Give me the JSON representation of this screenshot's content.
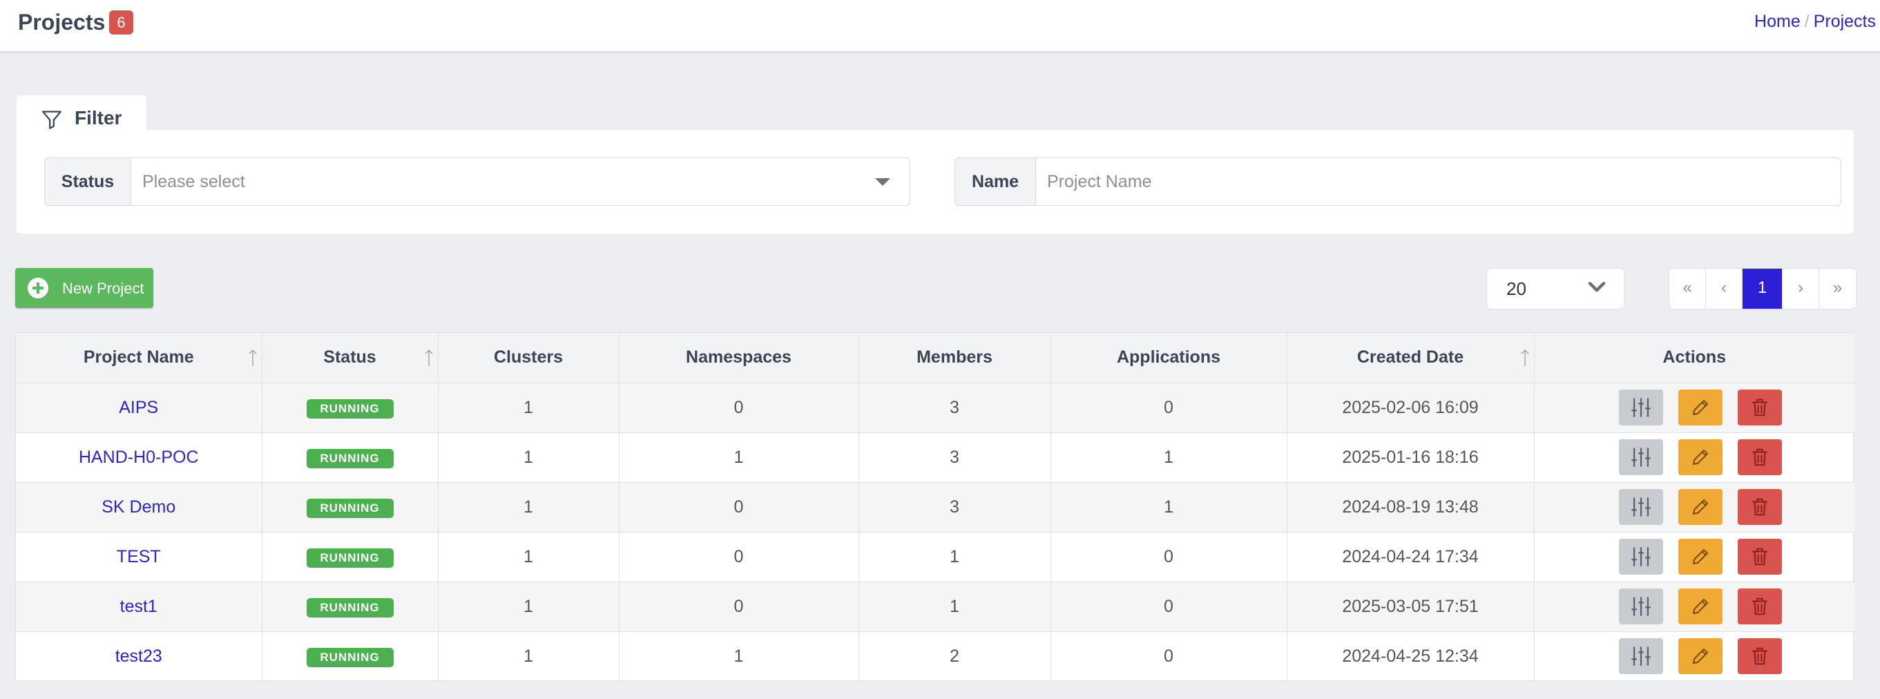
{
  "header": {
    "title": "Projects",
    "count": "6",
    "breadcrumb": {
      "home": "Home",
      "separator": "/",
      "current": "Projects"
    }
  },
  "filter": {
    "tab_label": "Filter",
    "status_label": "Status",
    "status_placeholder": "Please select",
    "name_label": "Name",
    "name_placeholder": "Project Name"
  },
  "toolbar": {
    "new_project_label": "New Project",
    "page_size": "20",
    "pagination": {
      "first": "«",
      "prev": "‹",
      "current": "1",
      "next": "›",
      "last": "»"
    }
  },
  "table": {
    "columns": [
      "Project Name",
      "Status",
      "Clusters",
      "Namespaces",
      "Members",
      "Applications",
      "Created Date",
      "Actions"
    ],
    "rows": [
      {
        "name": "AIPS",
        "status": "RUNNING",
        "clusters": "1",
        "namespaces": "0",
        "members": "3",
        "applications": "0",
        "created": "2025-02-06 16:09"
      },
      {
        "name": "HAND-H0-POC",
        "status": "RUNNING",
        "clusters": "1",
        "namespaces": "1",
        "members": "3",
        "applications": "1",
        "created": "2025-01-16 18:16"
      },
      {
        "name": "SK Demo",
        "status": "RUNNING",
        "clusters": "1",
        "namespaces": "0",
        "members": "3",
        "applications": "1",
        "created": "2024-08-19 13:48"
      },
      {
        "name": "TEST",
        "status": "RUNNING",
        "clusters": "1",
        "namespaces": "0",
        "members": "1",
        "applications": "0",
        "created": "2024-04-24 17:34"
      },
      {
        "name": "test1",
        "status": "RUNNING",
        "clusters": "1",
        "namespaces": "0",
        "members": "1",
        "applications": "0",
        "created": "2025-03-05 17:51"
      },
      {
        "name": "test23",
        "status": "RUNNING",
        "clusters": "1",
        "namespaces": "1",
        "members": "2",
        "applications": "0",
        "created": "2024-04-25 12:34"
      }
    ]
  },
  "colors": {
    "link": "#2c25c4",
    "badge": "#d9534f",
    "running": "#4caf50",
    "new_button": "#5cb85c",
    "edit": "#efa935",
    "delete": "#d9534f",
    "active_page": "#2c1fd6"
  },
  "icons": {
    "filter": "filter-icon",
    "new_project": "plus-circle-icon",
    "page_size": "chevron-down-icon",
    "sort": "sort-arrow-icon",
    "config": "sliders-icon",
    "edit": "pencil-icon",
    "delete": "trash-icon"
  }
}
